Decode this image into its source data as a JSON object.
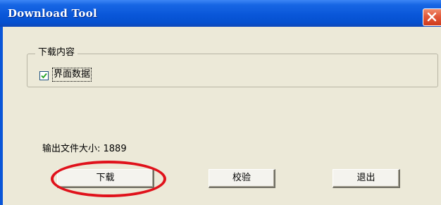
{
  "window": {
    "title": "Download Tool",
    "close_icon": "close-icon"
  },
  "group": {
    "legend": "下载内容",
    "checkbox": {
      "label": "界面数据",
      "checked": true
    }
  },
  "output": {
    "size_text": "输出文件大小: 1889"
  },
  "buttons": {
    "download": "下载",
    "verify": "校验",
    "exit": "退出"
  },
  "annotation": {
    "highlight_color": "#e0121b"
  },
  "colors": {
    "titlebar": "#0a57d9",
    "dialog_background": "#ece9d8",
    "close_button": "#e2593b"
  }
}
